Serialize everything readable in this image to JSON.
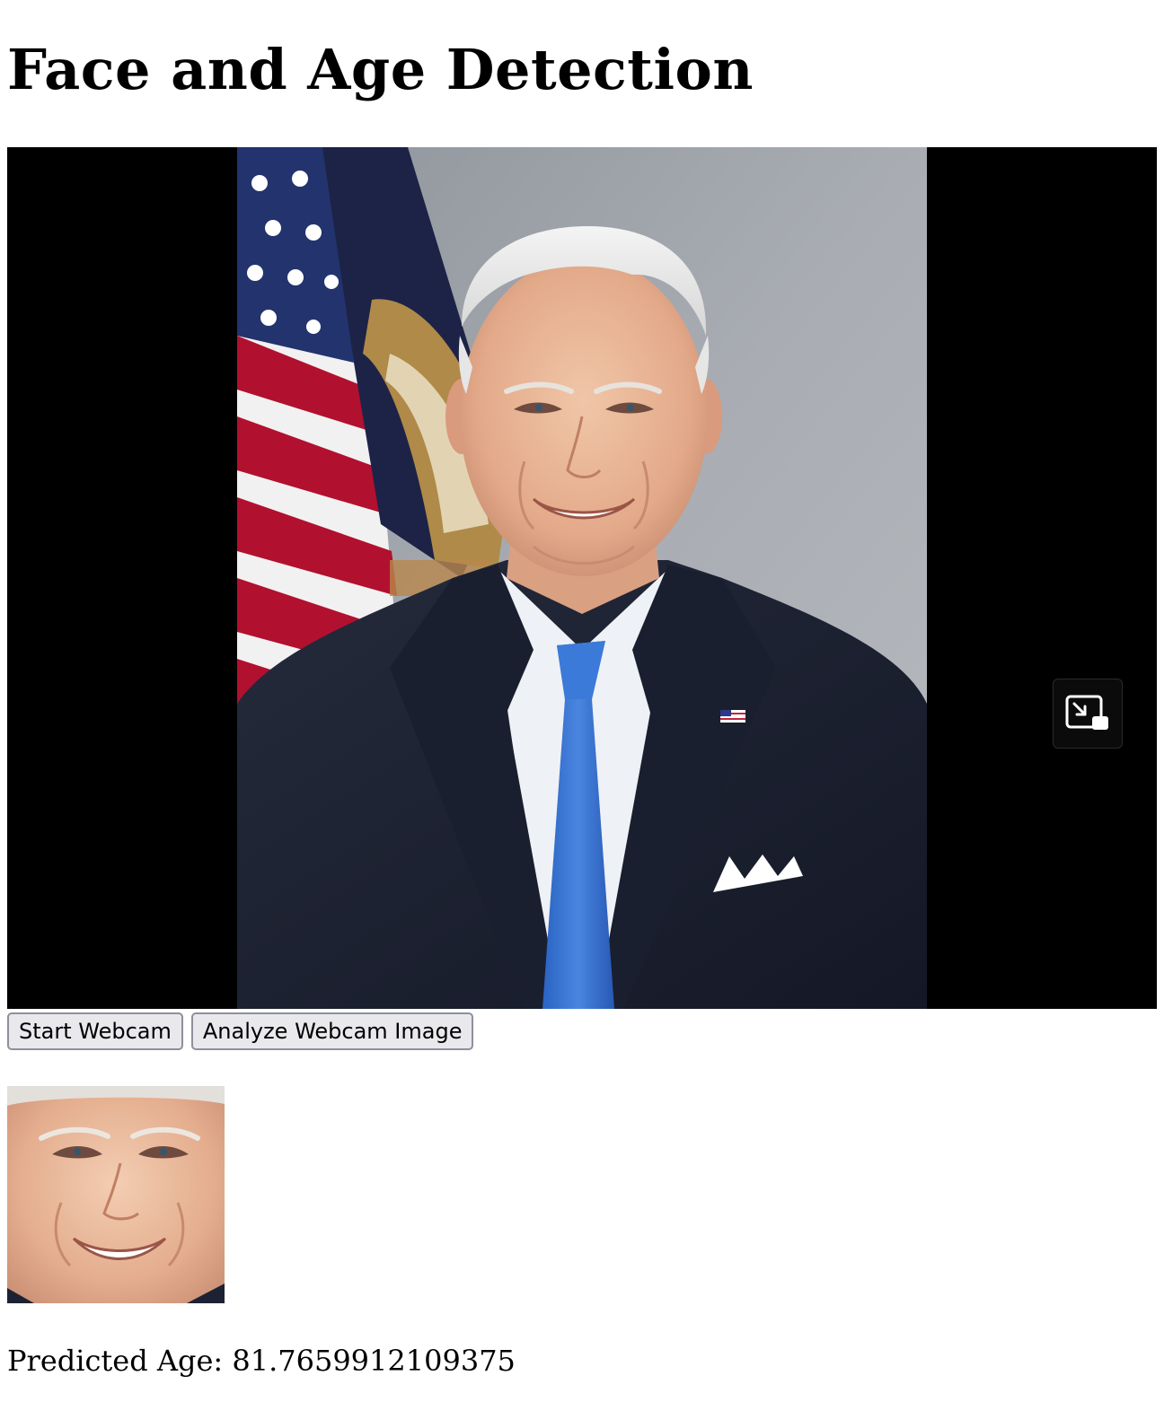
{
  "page": {
    "title": "Face and Age Detection"
  },
  "video": {
    "pip_icon": "picture-in-picture-icon",
    "frame_image": "presidential-portrait-photo",
    "background_color": "#000000"
  },
  "controls": {
    "start_webcam_label": "Start Webcam",
    "analyze_label": "Analyze Webcam Image"
  },
  "result": {
    "face_image": "detected-face-crop-photo",
    "age_text": "Predicted Age: 81.7659912109375"
  },
  "colors": {
    "button_bg": "#e9e9ed",
    "button_border": "#8f8f9d",
    "tie_blue": "#2f6fd0",
    "suit_navy": "#1c2233"
  }
}
